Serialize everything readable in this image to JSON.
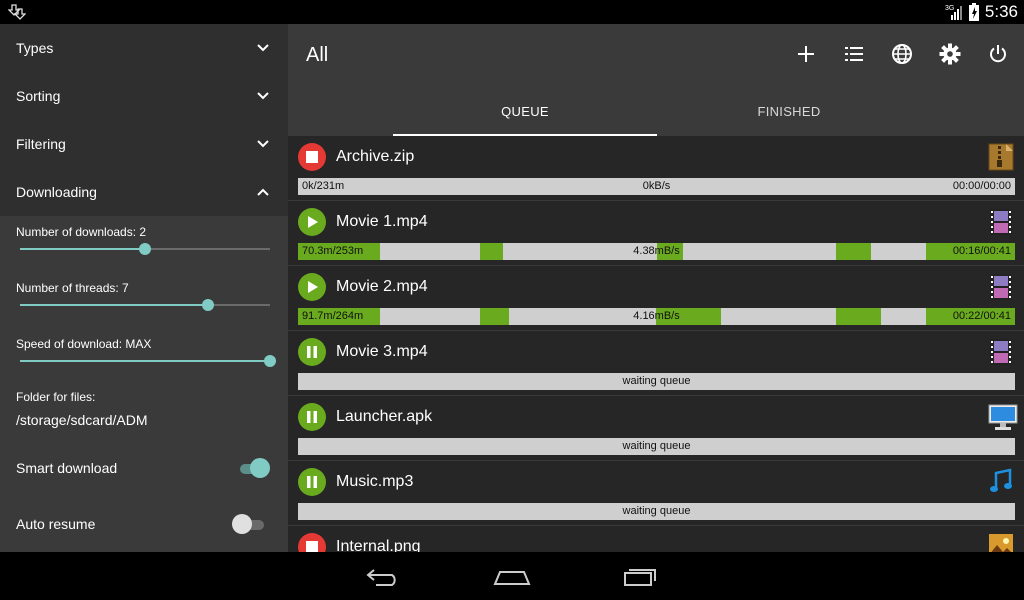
{
  "status": {
    "time": "5:36",
    "network": "3G"
  },
  "drawer": {
    "sections": [
      {
        "label": "Types",
        "expanded": false
      },
      {
        "label": "Sorting",
        "expanded": false
      },
      {
        "label": "Filtering",
        "expanded": false
      },
      {
        "label": "Downloading",
        "expanded": true
      }
    ],
    "num_downloads_label": "Number of downloads: 2",
    "num_downloads_value": 0.5,
    "num_threads_label": "Number of threads: 7",
    "num_threads_value": 0.75,
    "speed_label": "Speed of download: MAX",
    "speed_value": 1.0,
    "folder_label": "Folder for files:",
    "folder_path": "/storage/sdcard/ADM",
    "smart_download_label": "Smart download",
    "smart_download_on": true,
    "auto_resume_label": "Auto resume",
    "auto_resume_on": false
  },
  "appbar": {
    "title": "All",
    "actions": [
      "add-icon",
      "list-icon",
      "globe-icon",
      "settings-icon",
      "power-icon"
    ]
  },
  "tabs": {
    "queue": "QUEUE",
    "finished": "FINISHED"
  },
  "colors": {
    "accent": "#80cbc4",
    "progress": "#6aaa1e",
    "stop": "#e53935"
  },
  "downloads": [
    {
      "name": "Archive.zip",
      "state": "stop",
      "icon": "archive-icon",
      "left": "0k/231m",
      "mid": "0kB/s",
      "right": "00:00/00:00"
    },
    {
      "name": "Movie 1.mp4",
      "state": "play",
      "icon": "video-icon",
      "left": "70.3m/253m",
      "mid": "4.38mB/s",
      "right": "00:16/00:41"
    },
    {
      "name": "Movie 2.mp4",
      "state": "play",
      "icon": "video-icon",
      "left": "91.7m/264m",
      "mid": "4.16mB/s",
      "right": "00:22/00:41"
    },
    {
      "name": "Movie 3.mp4",
      "state": "pause",
      "icon": "video-icon",
      "left": "",
      "mid": "waiting queue",
      "right": ""
    },
    {
      "name": "Launcher.apk",
      "state": "pause",
      "icon": "monitor-icon",
      "left": "",
      "mid": "waiting queue",
      "right": ""
    },
    {
      "name": "Music.mp3",
      "state": "pause",
      "icon": "music-icon",
      "left": "",
      "mid": "waiting queue",
      "right": ""
    },
    {
      "name": "Internal.png",
      "state": "stop",
      "icon": "image-icon",
      "left": "",
      "mid": "",
      "right": ""
    }
  ]
}
